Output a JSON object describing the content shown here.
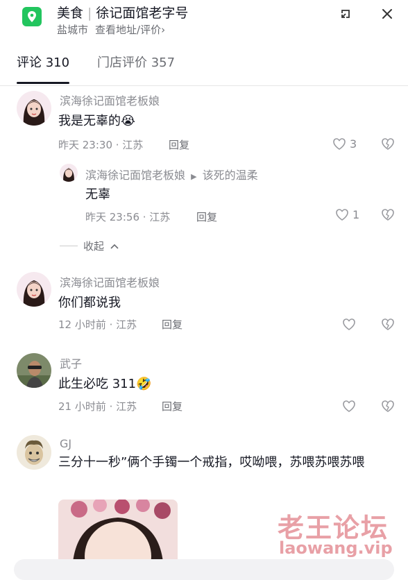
{
  "header": {
    "category": "美食",
    "store_name": "徐记面馆老字号",
    "city": "盐城市",
    "address_link": "查看地址/评价",
    "chevron": "›"
  },
  "tabs": [
    {
      "label": "评论 310",
      "active": true
    },
    {
      "label": "门店评价 357",
      "active": false
    }
  ],
  "comments": [
    {
      "username": "滨海徐记面馆老板娘",
      "text": "我是无辜的",
      "emoji": "😭",
      "time": "昨天 23:30 · 江苏",
      "reply_label": "回复",
      "likes": "3",
      "avatar_icon": "girl-avatar"
    },
    {
      "username": "滨海徐记面馆老板娘",
      "reply_to": "该死的温柔",
      "text": "无辜",
      "time": "昨天 23:56 · 江苏",
      "reply_label": "回复",
      "likes": "1",
      "avatar_icon": "girl-avatar"
    },
    {
      "username": "滨海徐记面馆老板娘",
      "text": "你们都说我",
      "time": "12 小时前 · 江苏",
      "reply_label": "回复",
      "likes": "",
      "avatar_icon": "girl-avatar"
    },
    {
      "username": "武子",
      "text": "此生必吃 311",
      "emoji": "🤣",
      "time": "21 小时前 · 江苏",
      "reply_label": "回复",
      "likes": "",
      "avatar_icon": "man-avatar"
    },
    {
      "username": "GJ",
      "text": "三分十一秒”俩个手镯一个戒指，哎呦喂，苏喂苏喂苏喂",
      "avatar_icon": "cartoon-avatar"
    }
  ],
  "collapse_label": "收起",
  "watermark": {
    "line1": "老王论坛",
    "line2": "laowang.vip"
  },
  "colors": {
    "accent": "#22c55e",
    "text": "#161823",
    "secondary": "#8a8b91",
    "watermark": "#e8a0a6"
  }
}
